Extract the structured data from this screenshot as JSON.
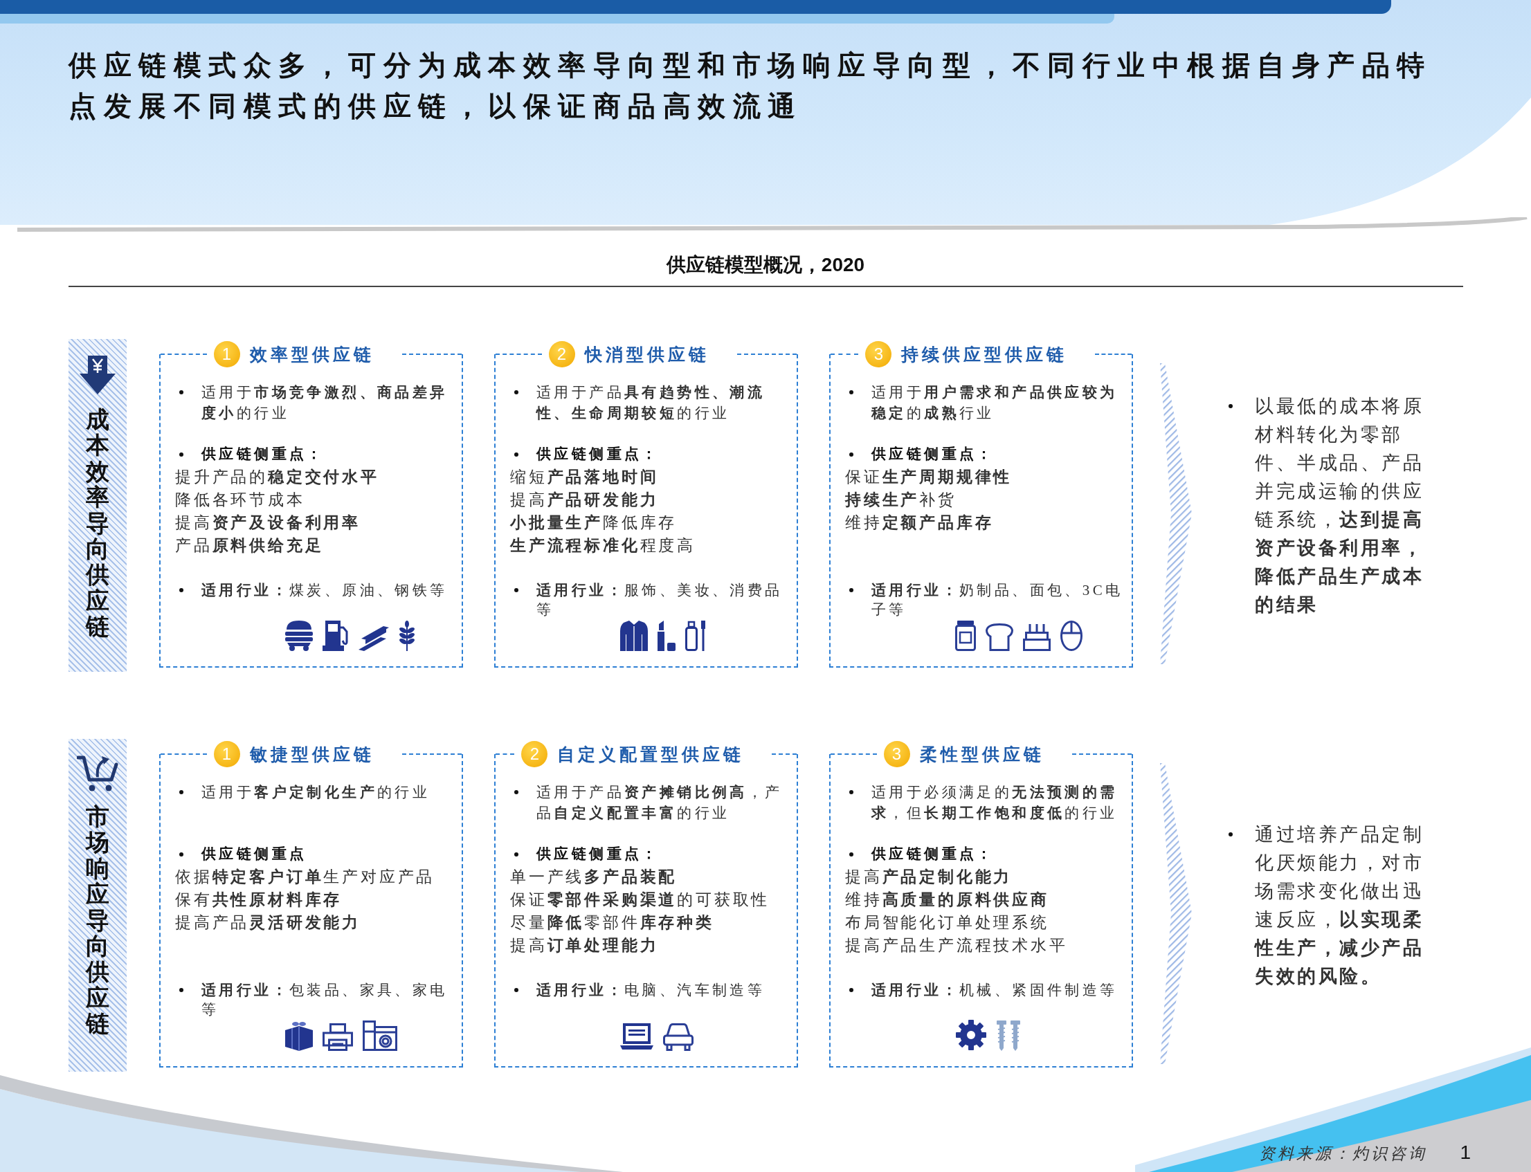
{
  "header": {
    "title": "供应链模式众多，可分为成本效率导向型和市场响应导向型，不同行业中根据自身产品特点发展不同模式的供应链，以保证商品高效流通"
  },
  "chart": {
    "title": "供应链模型概况，2020"
  },
  "groups": [
    {
      "kind": "cost",
      "label": "成本效率导向供应链",
      "cards": [
        {
          "number": "1",
          "title": "效率型供应链",
          "fit": "适用于**市场竞争激烈、商品差异度小**的行业",
          "focus_title": "供应链侧重点：",
          "focus": [
            "提升产品的**稳定交付水平**",
            "降低各环节成本",
            "提高**资产及设备利用率**",
            "产品**原料供给充足**"
          ],
          "industries": "**适用行业：**煤炭、原油、钢铁等"
        },
        {
          "number": "2",
          "title": "快消型供应链",
          "fit": "适用于产品**具有趋势性、潮流性、生命周期较短**的行业",
          "focus_title": "供应链侧重点：",
          "focus": [
            "缩短**产品落地时间**",
            "提高**产品研发能力**",
            "**小批量生产**降低库存",
            "**生产流程标准化**程度高"
          ],
          "industries": "**适用行业：**服饰、美妆、消费品等"
        },
        {
          "number": "3",
          "title": "持续供应型供应链",
          "fit": "适用于**用户需求和产品供应较为稳定**的**成熟**行业",
          "focus_title": "供应链侧重点：",
          "focus": [
            "保证**生产周期规律性**",
            "**持续生产**补货",
            "维持**定额产品库存**"
          ],
          "industries": "**适用行业：**奶制品、面包、3C电子等"
        }
      ],
      "summary": "以最低的成本将原材料转化为零部件、半成品、产品并完成运输的供应链系统，**达到提高资产设备利用率，降低产品生产成本的结果**"
    },
    {
      "kind": "market",
      "label": "市场响应导向供应链",
      "cards": [
        {
          "number": "1",
          "title": "敏捷型供应链",
          "fit": "适用于**客户定制化生产**的行业",
          "focus_title": "供应链侧重点",
          "focus": [
            "依据**特定客户订单**生产对应产品",
            "保有**共性原材料库存**",
            "提高产品**灵活研发能力**"
          ],
          "industries": "**适用行业：**包装品、家具、家电等"
        },
        {
          "number": "2",
          "title": "自定义配置型供应链",
          "fit": "适用于产品**资产摊销比例高**，产品**自定义配置丰富**的行业",
          "focus_title": "供应链侧重点：",
          "focus": [
            "单一产线**多产品装配**",
            "保证**零部件采购渠道**的可获取性",
            "尽量**降低**零部件**库存种类**",
            "提高**订单处理能力**"
          ],
          "industries": "**适用行业：**电脑、汽车制造等"
        },
        {
          "number": "3",
          "title": "柔性型供应链",
          "fit": "适用于必须满足的**无法预测的需求**，但**长期工作饱和度低**的行业",
          "focus_title": "供应链侧重点：",
          "focus": [
            "提高**产品定制化能力**",
            "维持**高质量的原料供应商**",
            "布局智能化订单处理系统",
            "提高产品生产流程技术水平"
          ],
          "industries": "**适用行业：**机械、紧固件制造等"
        }
      ],
      "summary": "通过培养产品定制化厌烦能力，对市场需求变化做出迅速反应，**以实现柔性生产，减少产品失效的风险。**"
    }
  ],
  "footer": {
    "source": "资料来源：灼识咨询",
    "page": "1"
  }
}
